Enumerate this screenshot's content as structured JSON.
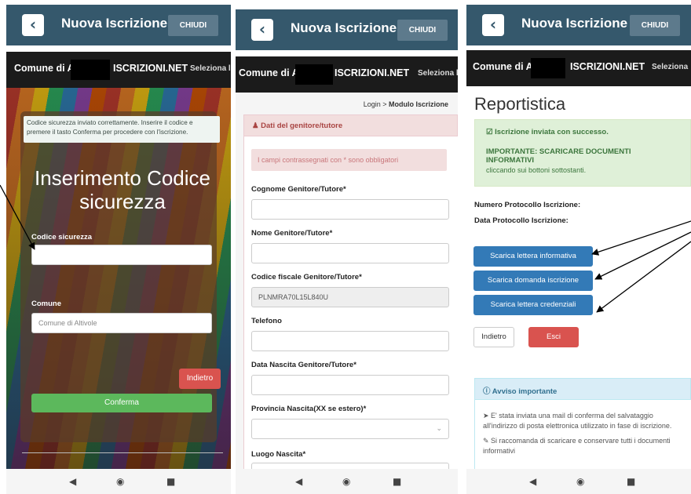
{
  "app": {
    "back_icon": "chevron-left-icon",
    "title": "Nuova Iscrizione",
    "close_label": "CHIUDI"
  },
  "site": {
    "brand_prefix": "Comune di A",
    "brand_suffix": "ISCRIZIONI.NET",
    "select_p1": "Seleziona li",
    "select_p2": "Seleziona li",
    "select_p3": "Seleziona"
  },
  "screen1": {
    "info_message": "Codice sicurezza inviato correttamente. Inserire il codice e premere il tasto Conferma per procedere con l'iscrizione.",
    "heading": "Inserimento Codice sicurezza",
    "code_label": "Codice sicurezza",
    "code_value": "",
    "comune_label": "Comune",
    "comune_value": "Comune di Altivole",
    "back_label": "Indietro",
    "confirm_label": "Conferma"
  },
  "screen2": {
    "breadcrumb_login": "Login",
    "breadcrumb_sep": " > ",
    "breadcrumb_current": "Modulo Iscrizione",
    "panel_title": "Dati del genitore/tutore",
    "required_note": "I campi contrassegnati con * sono obbligatori",
    "fields": [
      {
        "label": "Cognome Genitore/Tutore*",
        "value": ""
      },
      {
        "label": "Nome Genitore/Tutore*",
        "value": ""
      },
      {
        "label": "Codice fiscale Genitore/Tutore*",
        "value": "PLNMRA70L15L840U"
      },
      {
        "label": "Telefono",
        "value": ""
      },
      {
        "label": "Data Nascita Genitore/Tutore*",
        "value": ""
      },
      {
        "label": "Provincia Nascita(XX se estero)*",
        "value": ""
      },
      {
        "label": "Luogo Nascita*",
        "value": ""
      }
    ]
  },
  "screen3": {
    "title": "Reportistica",
    "success_line": "Iscrizione inviata con successo.",
    "important_line": "IMPORTANTE: SCARICARE DOCUMENTI INFORMATIVI",
    "important_sub": "cliccando sui bottoni sottostanti.",
    "protocol_number_label": "Numero Protocollo Iscrizione:",
    "protocol_date_label": "Data Protocollo Iscrizione:",
    "download_buttons": [
      "Scarica lettera informativa",
      "Scarica domanda iscrizione",
      "Scarica lettera credenziali"
    ],
    "back_label": "Indietro",
    "exit_label": "Esci",
    "notice_title": "Avviso importante",
    "notice_1": "E' stata inviata una mail di conferma del salvataggio all'indirizzo di posta elettronica utilizzato in fase di iscrizione.",
    "notice_2": "Si raccomanda di scaricare e conservare tutti i documenti informativi"
  },
  "nav": {
    "back": "◀",
    "home": "◉",
    "recent": "■"
  },
  "colors": {
    "appbar": "#35586c",
    "success_green": "#5cb85c",
    "danger_red": "#d9534f",
    "primary_blue": "#337ab7"
  }
}
